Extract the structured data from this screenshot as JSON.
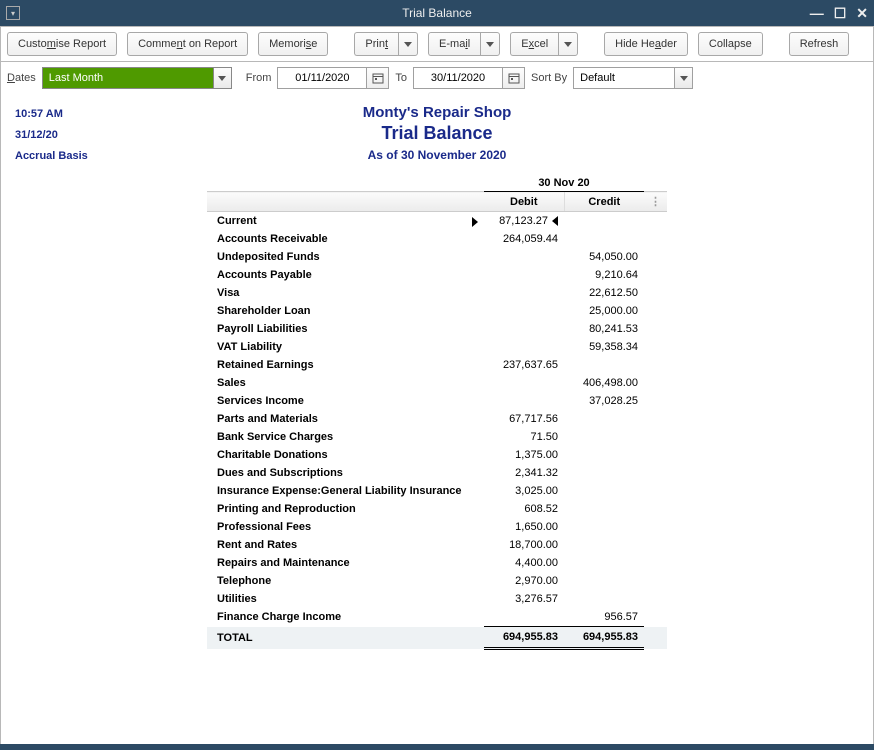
{
  "window": {
    "title": "Trial Balance"
  },
  "toolbar": {
    "customise": "Customise Report",
    "comment": "Comment on Report",
    "memorise": "Memorise",
    "print": "Print",
    "email": "E-mail",
    "excel": "Excel",
    "hide_header": "Hide Header",
    "collapse": "Collapse",
    "refresh": "Refresh"
  },
  "filter": {
    "dates_label": "Dates",
    "range": "Last Month",
    "from_label": "From",
    "from": "01/11/2020",
    "to_label": "To",
    "to": "30/11/2020",
    "sortby_label": "Sort By",
    "sortby": "Default"
  },
  "meta": {
    "time": "10:57 AM",
    "date": "31/12/20",
    "basis": "Accrual Basis"
  },
  "header": {
    "company": "Monty's Repair Shop",
    "title": "Trial Balance",
    "asof": "As of 30 November 2020"
  },
  "columns": {
    "date_span": "30 Nov 20",
    "debit": "Debit",
    "credit": "Credit"
  },
  "rows": [
    {
      "label": "Current",
      "debit": "87,123.27",
      "credit": "",
      "first": true
    },
    {
      "label": "Accounts Receivable",
      "debit": "264,059.44",
      "credit": ""
    },
    {
      "label": "Undeposited Funds",
      "debit": "",
      "credit": "54,050.00"
    },
    {
      "label": "Accounts Payable",
      "debit": "",
      "credit": "9,210.64"
    },
    {
      "label": "Visa",
      "debit": "",
      "credit": "22,612.50"
    },
    {
      "label": "Shareholder Loan",
      "debit": "",
      "credit": "25,000.00"
    },
    {
      "label": "Payroll Liabilities",
      "debit": "",
      "credit": "80,241.53"
    },
    {
      "label": "VAT Liability",
      "debit": "",
      "credit": "59,358.34"
    },
    {
      "label": "Retained Earnings",
      "debit": "237,637.65",
      "credit": ""
    },
    {
      "label": "Sales",
      "debit": "",
      "credit": "406,498.00"
    },
    {
      "label": "Services Income",
      "debit": "",
      "credit": "37,028.25"
    },
    {
      "label": "Parts and Materials",
      "debit": "67,717.56",
      "credit": ""
    },
    {
      "label": "Bank Service Charges",
      "debit": "71.50",
      "credit": ""
    },
    {
      "label": "Charitable Donations",
      "debit": "1,375.00",
      "credit": ""
    },
    {
      "label": "Dues and Subscriptions",
      "debit": "2,341.32",
      "credit": ""
    },
    {
      "label": "Insurance Expense:General Liability Insurance",
      "debit": "3,025.00",
      "credit": ""
    },
    {
      "label": "Printing and Reproduction",
      "debit": "608.52",
      "credit": ""
    },
    {
      "label": "Professional Fees",
      "debit": "1,650.00",
      "credit": ""
    },
    {
      "label": "Rent and Rates",
      "debit": "18,700.00",
      "credit": ""
    },
    {
      "label": "Repairs and Maintenance",
      "debit": "4,400.00",
      "credit": ""
    },
    {
      "label": "Telephone",
      "debit": "2,970.00",
      "credit": ""
    },
    {
      "label": "Utilities",
      "debit": "3,276.57",
      "credit": ""
    },
    {
      "label": "Finance Charge Income",
      "debit": "",
      "credit": "956.57"
    }
  ],
  "total": {
    "label": "TOTAL",
    "debit": "694,955.83",
    "credit": "694,955.83"
  }
}
